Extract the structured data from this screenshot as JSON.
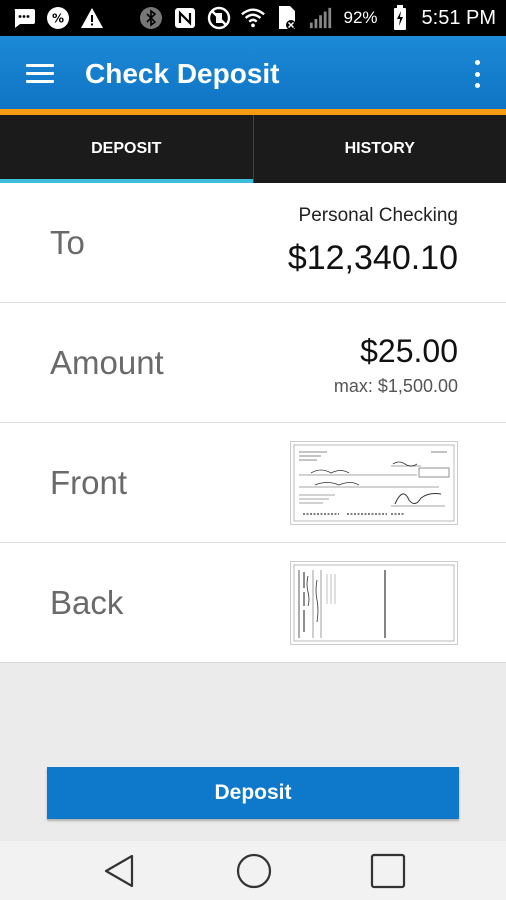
{
  "status_bar": {
    "battery_percent": "92%",
    "time": "5:51 PM"
  },
  "app_bar": {
    "title": "Check Deposit"
  },
  "tabs": [
    {
      "label": "DEPOSIT",
      "active": true
    },
    {
      "label": "HISTORY",
      "active": false
    }
  ],
  "form": {
    "to": {
      "label": "To",
      "account_name": "Personal Checking",
      "balance": "$12,340.10"
    },
    "amount": {
      "label": "Amount",
      "value": "$25.00",
      "max": "max: $1,500.00"
    },
    "front": {
      "label": "Front"
    },
    "back": {
      "label": "Back"
    }
  },
  "deposit_button": {
    "label": "Deposit"
  },
  "colors": {
    "app_bar": "#1282d0",
    "accent_orange": "#f59c12",
    "tab_bar": "#1b1b1b",
    "tab_indicator": "#3dbdd9",
    "button": "#0e79cb"
  }
}
